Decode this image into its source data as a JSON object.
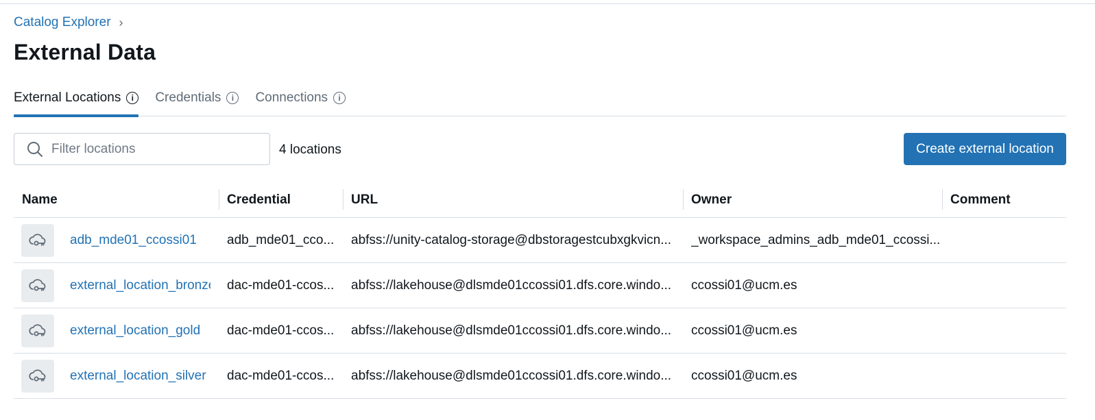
{
  "breadcrumb": {
    "link": "Catalog Explorer",
    "separator": "›"
  },
  "page": {
    "title": "External Data"
  },
  "tabs": [
    {
      "label": "External Locations",
      "active": true
    },
    {
      "label": "Credentials",
      "active": false
    },
    {
      "label": "Connections",
      "active": false
    }
  ],
  "toolbar": {
    "search_placeholder": "Filter locations",
    "search_value": "",
    "count_text": "4 locations",
    "create_label": "Create external location"
  },
  "table": {
    "columns": [
      "Name",
      "Credential",
      "URL",
      "Owner",
      "Comment"
    ],
    "rows": [
      {
        "icon": "cloud-key-icon",
        "name": "adb_mde01_ccossi01",
        "credential": "adb_mde01_cco...",
        "url": "abfss://unity-catalog-storage@dbstoragestcubxgkvicn...",
        "owner": "_workspace_admins_adb_mde01_ccossi...",
        "comment": ""
      },
      {
        "icon": "cloud-key-icon",
        "name": "external_location_bronze",
        "credential": "dac-mde01-ccos...",
        "url": "abfss://lakehouse@dlsmde01ccossi01.dfs.core.windo...",
        "owner": "ccossi01@ucm.es",
        "comment": ""
      },
      {
        "icon": "cloud-key-icon",
        "name": "external_location_gold",
        "credential": "dac-mde01-ccos...",
        "url": "abfss://lakehouse@dlsmde01ccossi01.dfs.core.windo...",
        "owner": "ccossi01@ucm.es",
        "comment": ""
      },
      {
        "icon": "cloud-key-icon",
        "name": "external_location_silver",
        "credential": "dac-mde01-ccos...",
        "url": "abfss://lakehouse@dlsmde01ccossi01.dfs.core.windo...",
        "owner": "ccossi01@ucm.es",
        "comment": ""
      }
    ]
  },
  "colors": {
    "accent": "#2272b4",
    "text": "#11171c",
    "muted": "#5f6b77",
    "border": "#d8dde3",
    "icon_bg": "#e9ecef"
  }
}
